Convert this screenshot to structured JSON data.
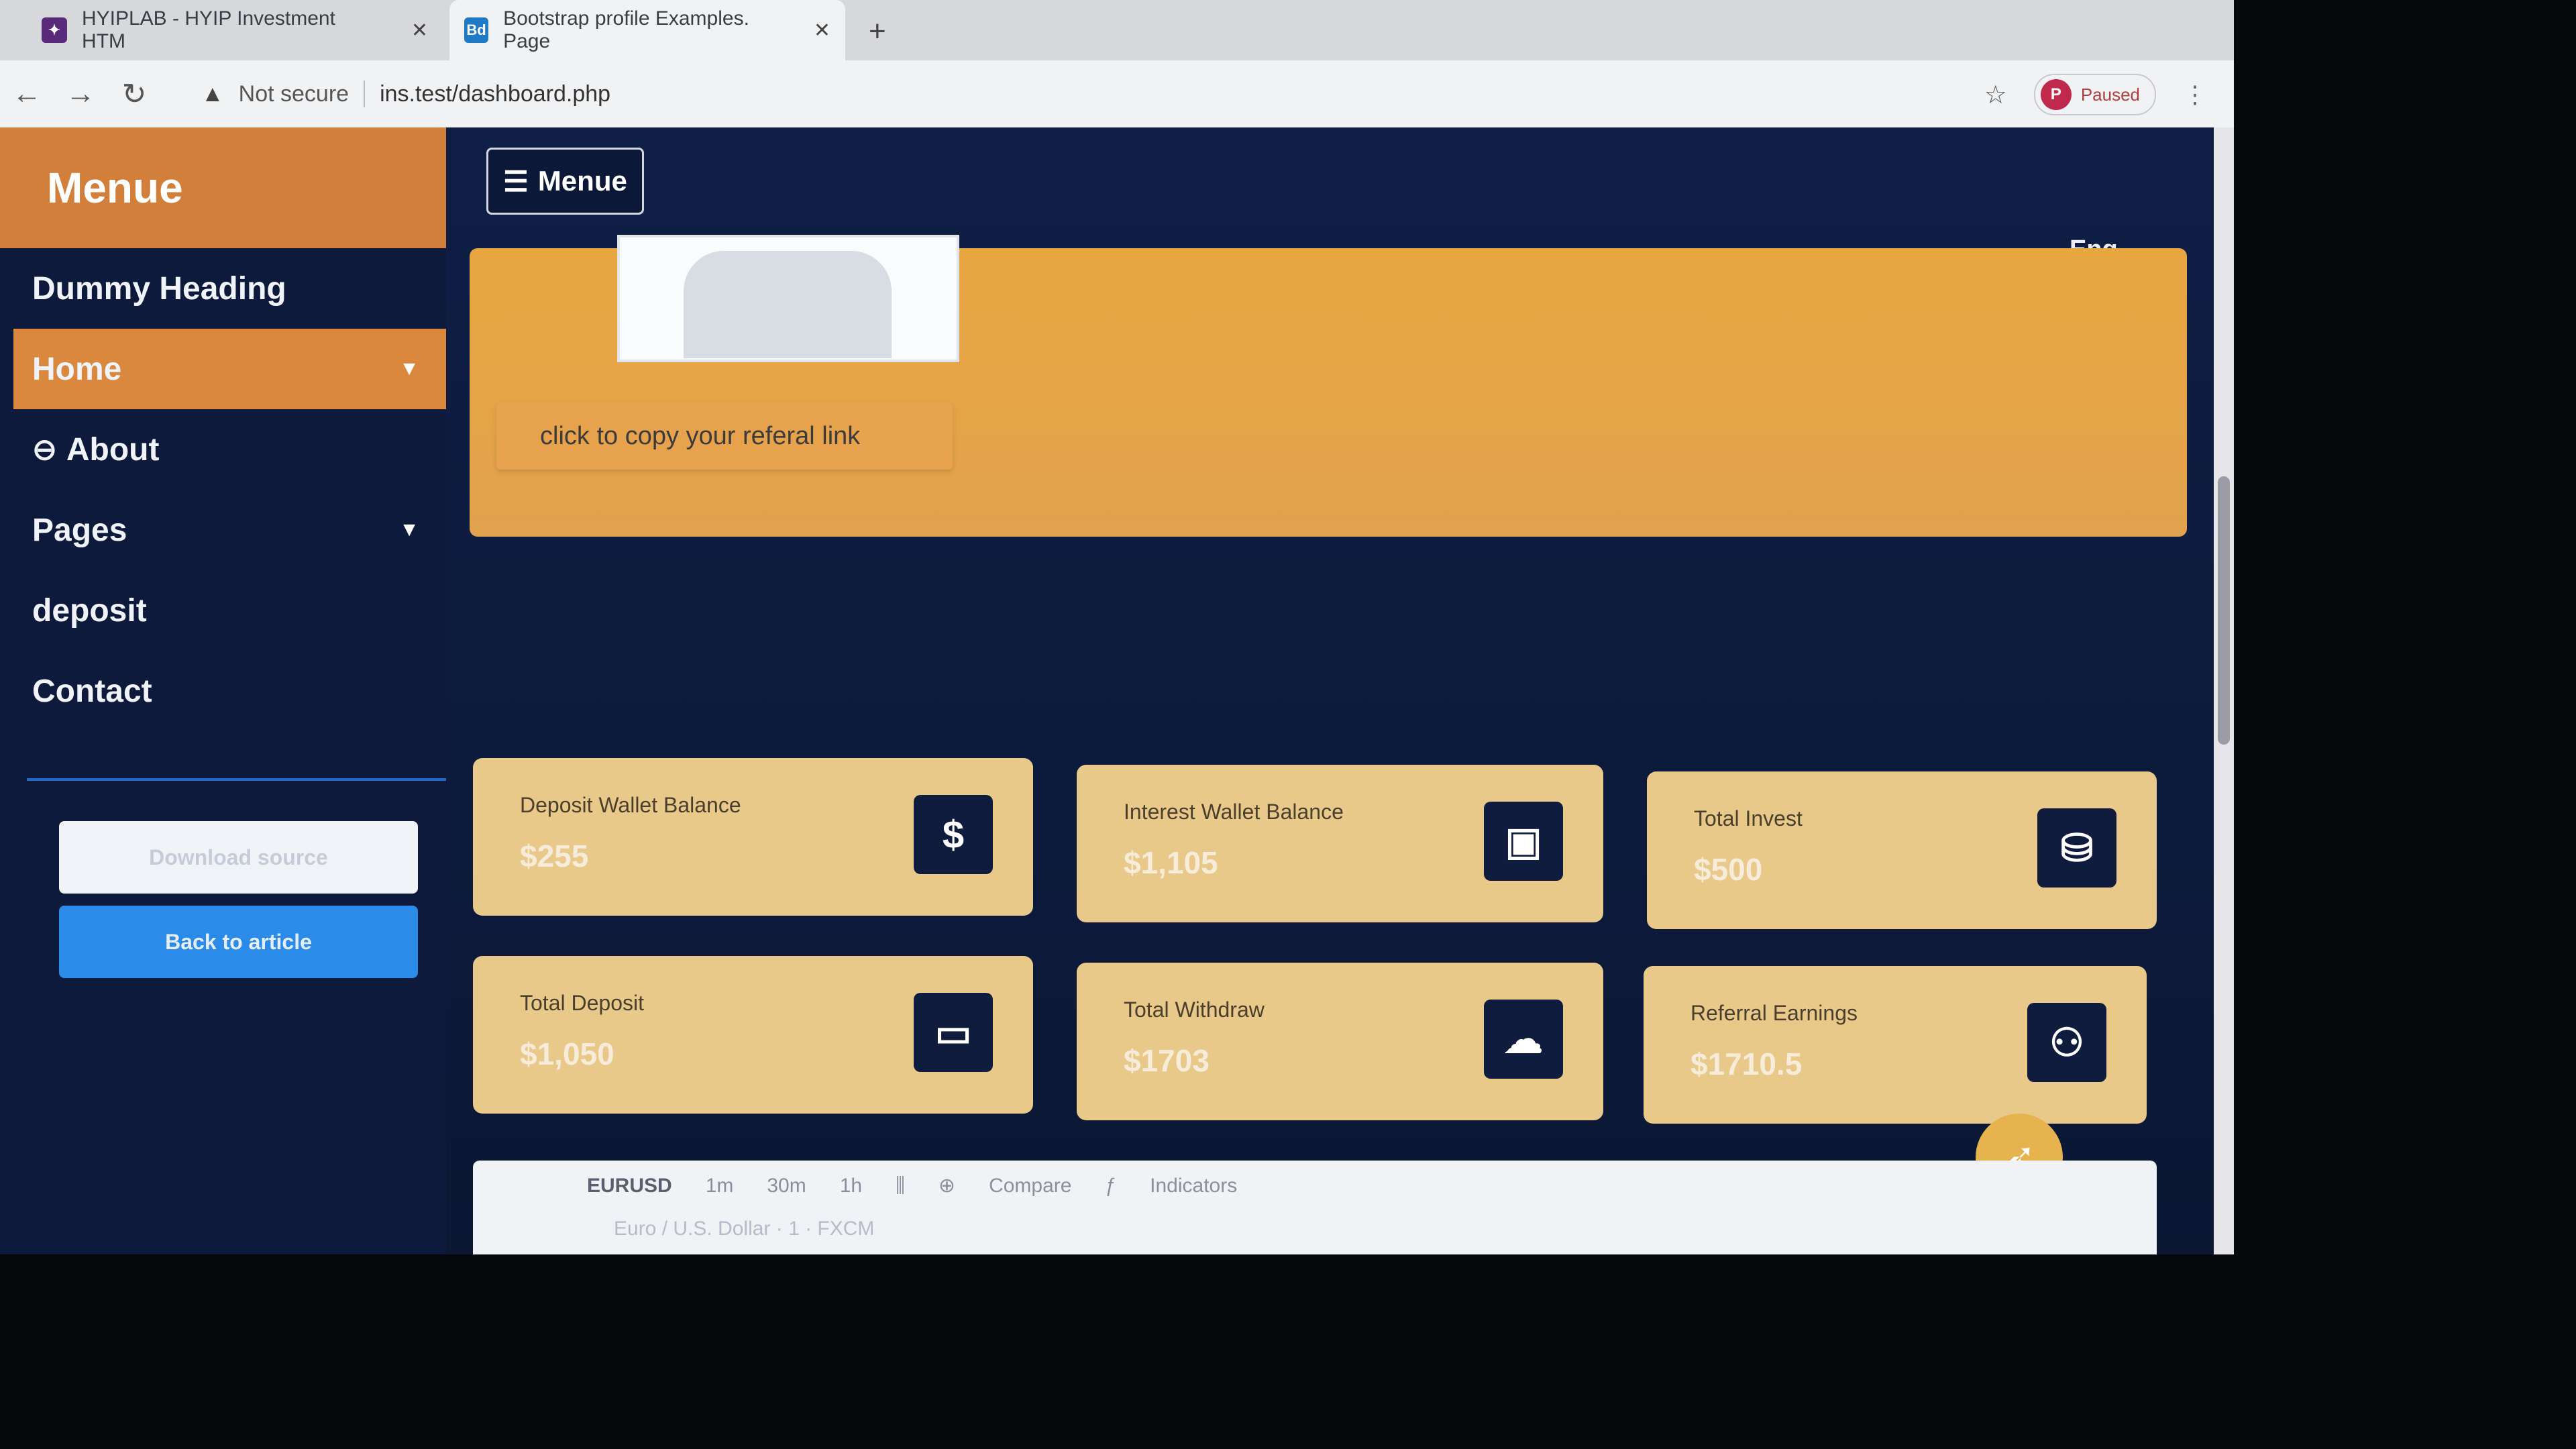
{
  "browser": {
    "tabs": [
      {
        "title": "HYIPLAB - HYIP Investment HTM",
        "favicon": "hyiplab-icon"
      },
      {
        "title": "Bootstrap profile Examples. Page",
        "favicon": "bootdey-icon",
        "favicon_text": "Bd"
      }
    ],
    "new_tab": "+",
    "security": "Not secure",
    "url": "ins.test/dashboard.php",
    "profile": {
      "initial": "P",
      "status": "Paused"
    }
  },
  "sidebar": {
    "brand": "Menue",
    "items": [
      {
        "label": "Dummy Heading"
      },
      {
        "label": "Home",
        "has_caret": true,
        "active": true
      },
      {
        "label": "About",
        "icon": "minus-circle-icon"
      },
      {
        "label": "Pages",
        "has_caret": true
      },
      {
        "label": "deposit"
      },
      {
        "label": "Contact"
      }
    ],
    "buttons": {
      "download": "Download source",
      "back": "Back to article"
    }
  },
  "main": {
    "menu_button": "Menue",
    "language": "Eng",
    "referral": {
      "copy_text": "click to copy your referal link"
    },
    "cards": [
      {
        "label": "Deposit Wallet Balance",
        "value": "$255",
        "icon": "dollar-icon"
      },
      {
        "label": "Interest Wallet Balance",
        "value": "$1,105",
        "icon": "wallet-icon"
      },
      {
        "label": "Total Invest",
        "value": "$500",
        "icon": "coins-icon"
      },
      {
        "label": "Total Deposit",
        "value": "$1,050",
        "icon": "credit-card-icon"
      },
      {
        "label": "Total Withdraw",
        "value": "$1703",
        "icon": "cloud-upload-icon"
      },
      {
        "label": "Referral Earnings",
        "value": "$1710.5",
        "icon": "users-icon"
      }
    ],
    "chart": {
      "symbol": "EURUSD",
      "intervals": [
        "1m",
        "30m",
        "1h"
      ],
      "compare": "Compare",
      "indicators": "Indicators",
      "subtitle": "Euro / U.S. Dollar · 1 · FXCM"
    }
  },
  "colors": {
    "sidebar_brand": "#d17f3a",
    "active_item": "#d9883e",
    "card_bg": "#e9c98a",
    "page_bg": "#0f1e45",
    "icon_box": "#0f1c3e",
    "blue_button": "#2a8ce8"
  }
}
